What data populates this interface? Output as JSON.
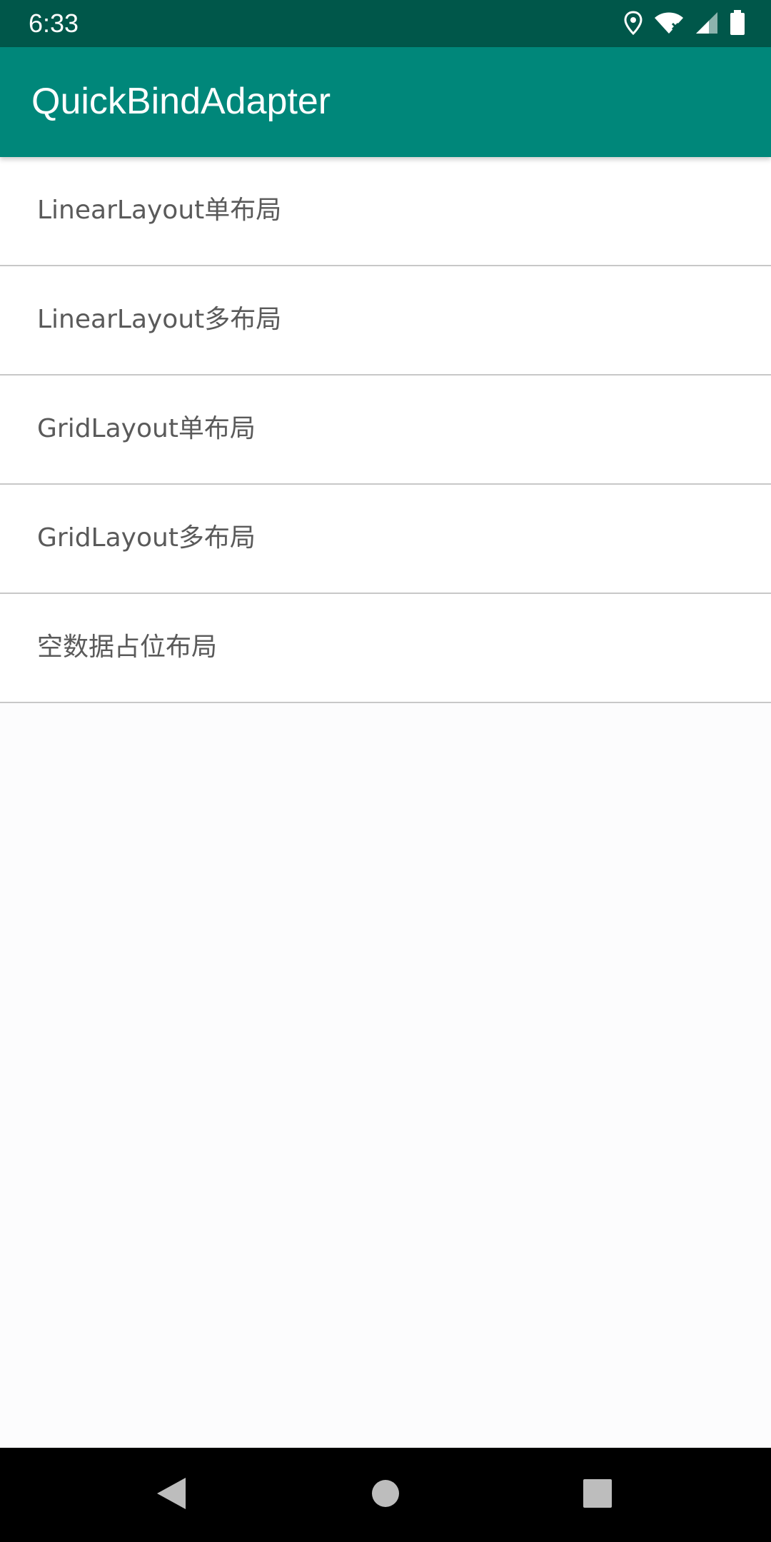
{
  "status_bar": {
    "time": "6:33",
    "icons": [
      "location-icon",
      "wifi-icon",
      "cell-signal-icon",
      "battery-icon"
    ]
  },
  "app_bar": {
    "title": "QuickBindAdapter"
  },
  "list": {
    "items": [
      {
        "label": "LinearLayout单布局"
      },
      {
        "label": "LinearLayout多布局"
      },
      {
        "label": "GridLayout单布局"
      },
      {
        "label": "GridLayout多布局"
      },
      {
        "label": "空数据占位布局"
      }
    ]
  },
  "nav_bar": {
    "buttons": [
      "back-icon",
      "home-icon",
      "recents-icon"
    ]
  },
  "colors": {
    "status_bar": "#00574a",
    "app_bar": "#00877a",
    "item_text": "#5a5a5a",
    "divider": "#c8c8c8"
  }
}
